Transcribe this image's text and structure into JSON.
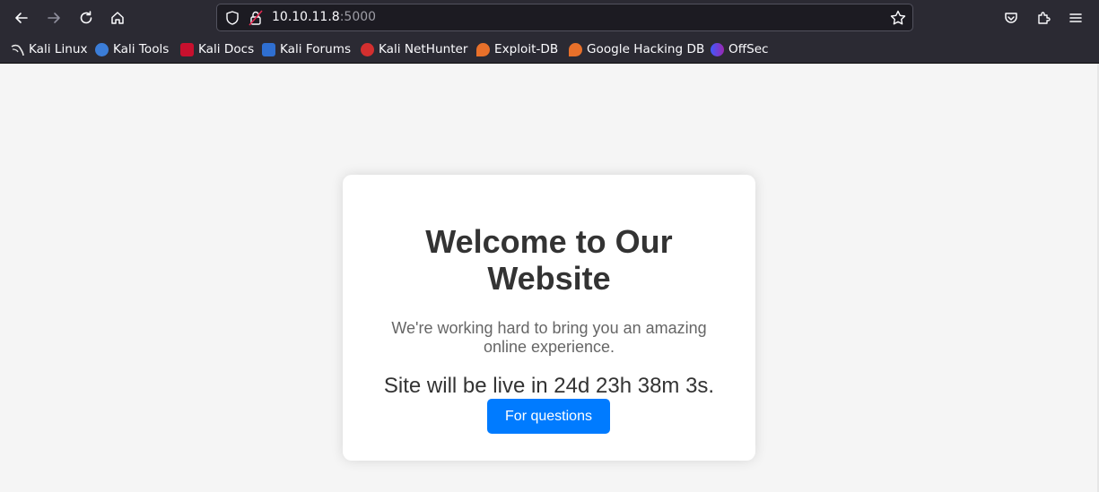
{
  "browser": {
    "url_host": "10.10.11.8",
    "url_port": ":5000",
    "bookmarks": [
      {
        "label": "Kali Linux",
        "icon": "kali-dragon-icon"
      },
      {
        "label": "Kali Tools",
        "icon": "kali-tools-icon"
      },
      {
        "label": "Kali Docs",
        "icon": "kali-docs-icon"
      },
      {
        "label": "Kali Forums",
        "icon": "kali-forums-icon"
      },
      {
        "label": "Kali NetHunter",
        "icon": "kali-nethunter-icon"
      },
      {
        "label": "Exploit-DB",
        "icon": "exploit-db-icon"
      },
      {
        "label": "Google Hacking DB",
        "icon": "ghdb-icon"
      },
      {
        "label": "OffSec",
        "icon": "offsec-icon"
      }
    ],
    "colors": {
      "chrome_bg": "#2b2a33",
      "urlbar_bg": "#1c1b22"
    }
  },
  "page": {
    "title": "Welcome to Our Website",
    "subtitle": "We're working hard to bring you an amazing online experience.",
    "countdown": "Site will be live in 24d 23h 38m 3s.",
    "button_label": "For questions",
    "colors": {
      "background": "#f5f5f5",
      "button": "#007bff",
      "heading": "#333333"
    }
  }
}
